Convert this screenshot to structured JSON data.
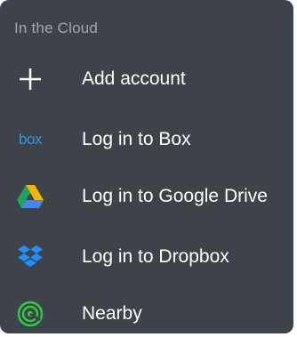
{
  "section": {
    "title": "In the Cloud"
  },
  "items": [
    {
      "label": "Add account",
      "icon": "plus-icon"
    },
    {
      "label": "Log in to Box",
      "icon": "box-logo-icon",
      "logo_text": "box",
      "color": "#2d9ae8"
    },
    {
      "label": "Log in to Google Drive",
      "icon": "google-drive-icon",
      "colors": [
        "#f5b400",
        "#1ea362",
        "#4285f4"
      ]
    },
    {
      "label": "Log in to Dropbox",
      "icon": "dropbox-icon",
      "color": "#1e90ff"
    },
    {
      "label": "Nearby",
      "icon": "nearby-icon",
      "color": "#2ecc40"
    }
  ],
  "colors": {
    "background": "#3e4249",
    "section_text": "#a3a7ad",
    "item_text": "#ffffff"
  }
}
